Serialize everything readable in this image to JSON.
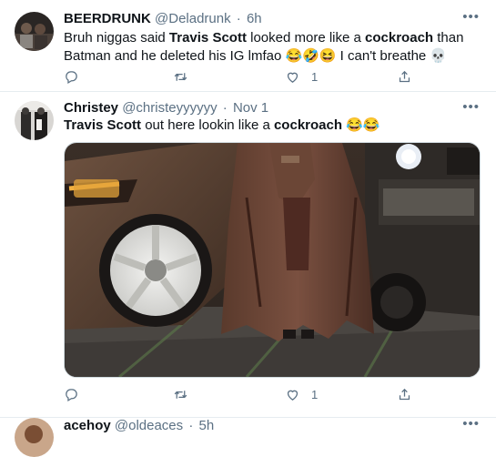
{
  "tweets": [
    {
      "name": "BEERDRUNK",
      "handle": "@Deladrunk",
      "time": "6h",
      "text_1": "Bruh niggas said ",
      "text_2": "Travis Scott",
      "text_3": " looked more like a ",
      "text_4": "cockroach",
      "text_5": " than Batman and he deleted his IG lmfao 😂🤣😆 I can't breathe 💀",
      "likes": "1"
    },
    {
      "name": "Christey",
      "handle": "@christeyyyyyy",
      "time": "Nov 1",
      "text_1": "Travis Scott",
      "text_2": " out here lookin like a ",
      "text_3": "cockroach",
      "text_4": " 😂😂",
      "likes": "1"
    },
    {
      "name": "acehoy",
      "handle": "@oldeaces",
      "time": "5h"
    }
  ],
  "icons": {
    "reply": "reply-icon",
    "retweet": "retweet-icon",
    "like": "like-icon",
    "share": "share-icon",
    "more": "more-icon"
  },
  "colors": {
    "text": "#0f1419",
    "secondary": "#5b7083",
    "divider": "#e6ecf0"
  }
}
